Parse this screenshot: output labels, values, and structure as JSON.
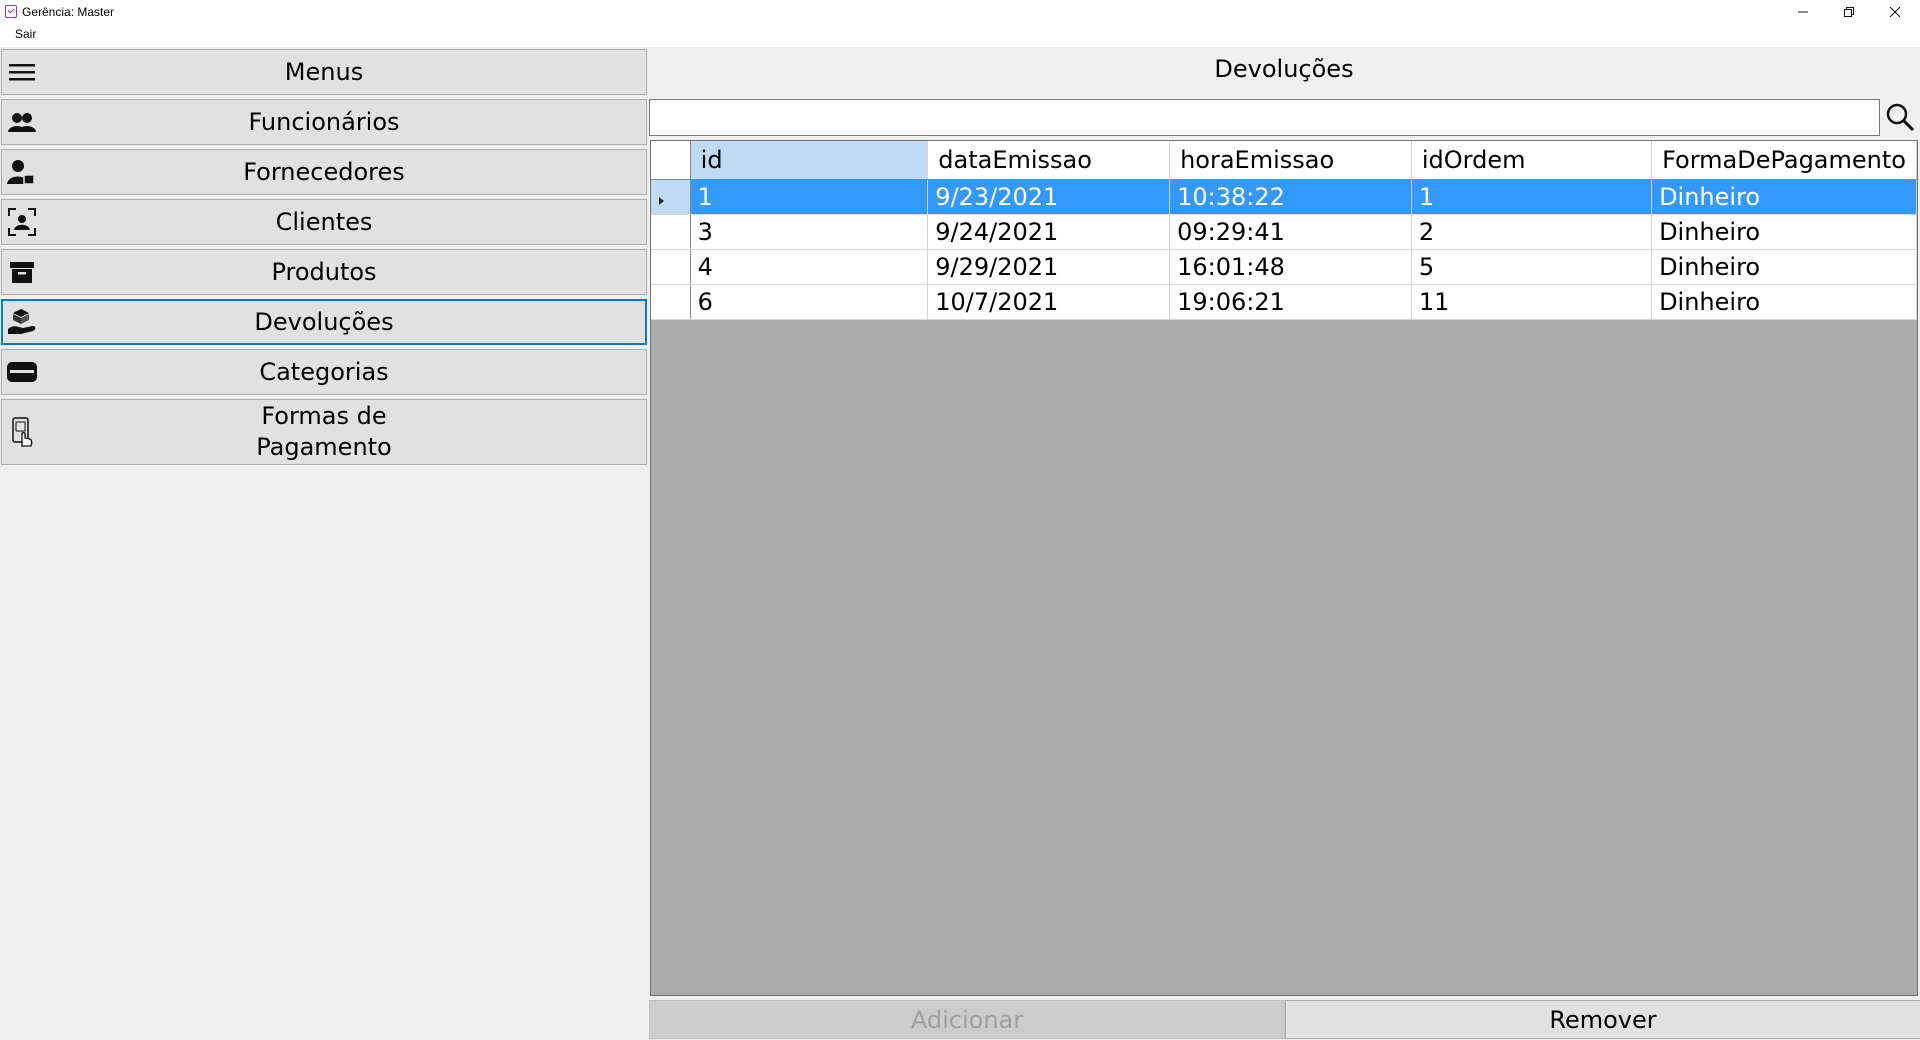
{
  "window": {
    "title": "Gerência: Master"
  },
  "menubar": {
    "sair": "Sair"
  },
  "sidebar": {
    "header": "Menus",
    "items": [
      {
        "label": "Funcionários",
        "icon": "users-icon"
      },
      {
        "label": "Fornecedores",
        "icon": "supplier-icon"
      },
      {
        "label": "Clientes",
        "icon": "client-icon"
      },
      {
        "label": "Produtos",
        "icon": "box-icon"
      },
      {
        "label": "Devoluções",
        "icon": "returns-hand-icon",
        "active": true
      },
      {
        "label": "Categorias",
        "icon": "card-icon"
      },
      {
        "label": "Formas de\nPagamento",
        "icon": "payment-touch-icon"
      }
    ]
  },
  "main": {
    "title": "Devoluções",
    "search": {
      "value": "",
      "placeholder": ""
    },
    "table": {
      "columns": [
        "id",
        "dataEmissao",
        "horaEmissao",
        "idOrdem",
        "FormaDePagamento"
      ],
      "rows": [
        [
          "1",
          "9/23/2021",
          "10:38:22",
          "1",
          "Dinheiro"
        ],
        [
          "3",
          "9/24/2021",
          "09:29:41",
          "2",
          "Dinheiro"
        ],
        [
          "4",
          "9/29/2021",
          "16:01:48",
          "5",
          "Dinheiro"
        ],
        [
          "6",
          "10/7/2021",
          "19:06:21",
          "11",
          "Dinheiro"
        ]
      ],
      "selected_row": 0
    },
    "buttons": {
      "add": "Adicionar",
      "remove": "Remover"
    }
  },
  "colors": {
    "selection": "#3399ff",
    "active_border": "#0078d7",
    "grid_bg": "#ababab"
  }
}
